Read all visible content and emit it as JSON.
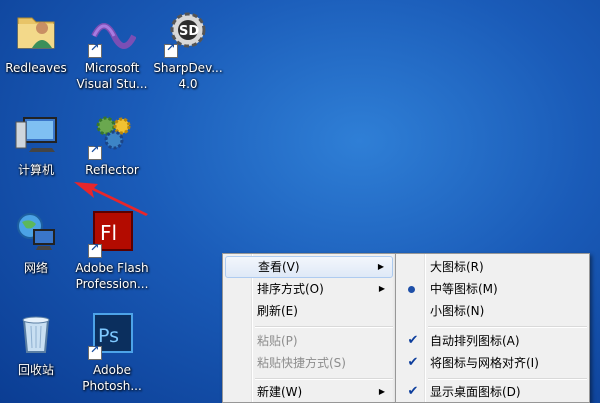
{
  "desktop": {
    "icons": [
      {
        "label": "Redleaves"
      },
      {
        "label": "Microsoft\nVisual Stu..."
      },
      {
        "label": "SharpDev...\n4.0"
      },
      {
        "label": "计算机"
      },
      {
        "label": "Reflector"
      },
      {
        "label": "网络"
      },
      {
        "label": "Adobe Flash\nProfession..."
      },
      {
        "label": "回收站"
      },
      {
        "label": "Adobe\nPhotosh..."
      }
    ]
  },
  "context_menu": {
    "items": [
      {
        "label": "查看(V)"
      },
      {
        "label": "排序方式(O)"
      },
      {
        "label": "刷新(E)"
      },
      {
        "label": "粘贴(P)"
      },
      {
        "label": "粘贴快捷方式(S)"
      },
      {
        "label": "新建(W)"
      }
    ]
  },
  "view_submenu": {
    "items": [
      {
        "label": "大图标(R)"
      },
      {
        "label": "中等图标(M)",
        "selected": true
      },
      {
        "label": "小图标(N)"
      },
      {
        "label": "自动排列图标(A)",
        "checked": true
      },
      {
        "label": "将图标与网格对齐(I)",
        "checked": true
      },
      {
        "label": "显示桌面图标(D)",
        "checked": true
      }
    ]
  },
  "colors": {
    "desktop_bg": "#1a5bb8",
    "menu_bg": "#f0f0f0",
    "highlight": "#dfe9f7",
    "annotation_arrow": "#e8262b"
  }
}
